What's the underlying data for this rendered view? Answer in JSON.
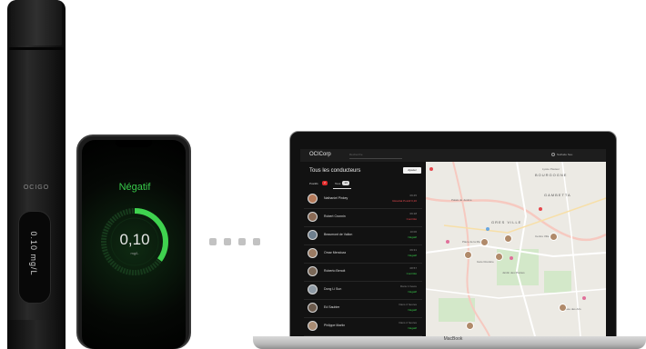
{
  "device": {
    "brand": "OCIGO",
    "reading": "0.10 mg/L"
  },
  "phone": {
    "status": "Négatif",
    "value": "0,10",
    "unit": "mg/L",
    "gauge_level": 0.35
  },
  "laptop": {
    "model": "MacBook",
    "app": {
      "logo": "OCICorp",
      "search_placeholder": "Recherche",
      "user_label": "Nathalie Neu",
      "list_title": "Tous les conducteurs",
      "add_button": "Ajouter",
      "tabs": [
        {
          "label": "Positifs",
          "count": "2"
        },
        {
          "label": "Tous",
          "count": "13"
        }
      ],
      "drivers": [
        {
          "name": "Nathaniel Pinkey",
          "time": "09:45",
          "status": "Résultat Positif 0,20",
          "status_color": "#e5484d"
        },
        {
          "name": "Robert Cronnin",
          "time": "09:18",
          "status": "Contrôlé",
          "status_color": "#e5484d"
        },
        {
          "name": "Beaumont de Vallon",
          "time": "10:06",
          "status": "Négatif",
          "status_color": "#38c94a"
        },
        {
          "name": "Omar Mendoza",
          "time": "09:31",
          "status": "Négatif",
          "status_color": "#38c94a"
        },
        {
          "name": "Roberto Benoit",
          "time": "08:57",
          "status": "Contrôlé",
          "status_color": "#38c94a"
        },
        {
          "name": "Dong Li Sun",
          "time": "Dans 1 heure",
          "status": "Négatif",
          "status_color": "#38c94a"
        },
        {
          "name": "Ed Saubier",
          "time": "Dans 2 heures",
          "status": "Négatif",
          "status_color": "#38c94a"
        },
        {
          "name": "Philippe Martin",
          "time": "Dans 2 heures",
          "status": "Négatif",
          "status_color": "#38c94a"
        }
      ]
    },
    "map": {
      "labels": [
        "GRES VILLE",
        "BOURGOGNE",
        "GAMBETTA",
        "Place de la Mairie",
        "Palais de Justice",
        "Gare Routière",
        "Centre Ville",
        "Jardin des Plantes",
        "Lycée Pasteur",
        "Musée des Arts"
      ]
    }
  },
  "colors": {
    "accent_green": "#38c94a",
    "alert_red": "#e02c2c",
    "map_bg": "#eceae4"
  }
}
